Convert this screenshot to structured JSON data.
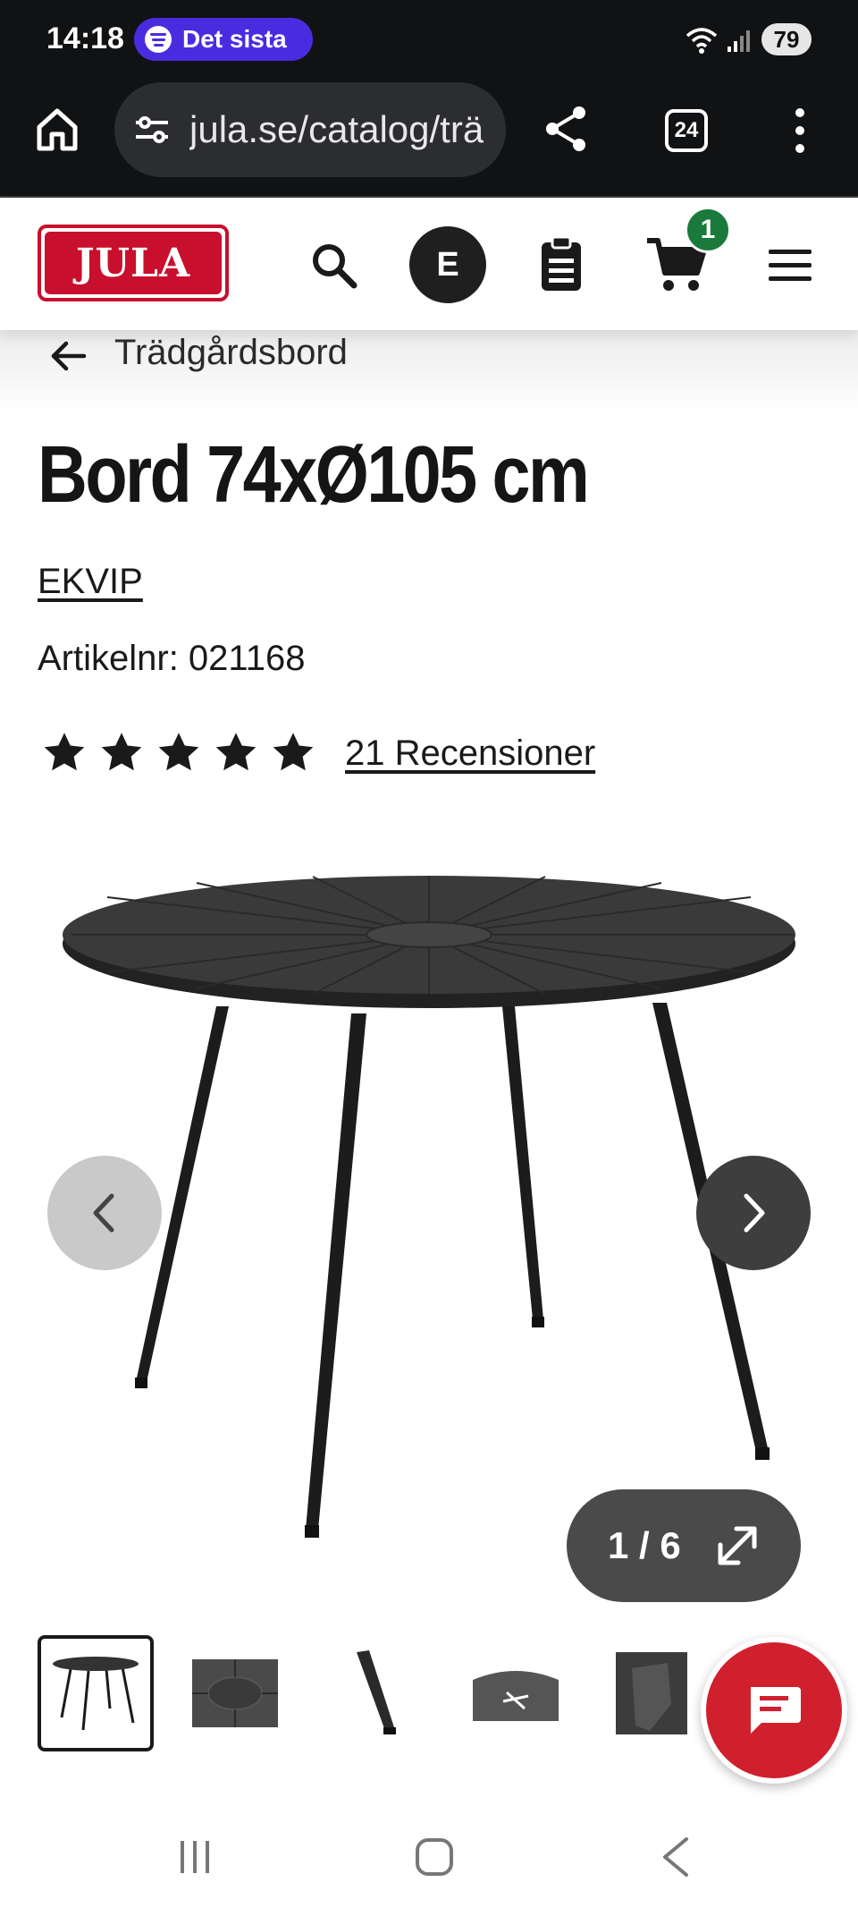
{
  "status_bar": {
    "time": "14:18",
    "media_label": "Det sista",
    "battery": "79"
  },
  "browser": {
    "url": "jula.se/catalog/trä",
    "tab_count": "24"
  },
  "header": {
    "logo_text": "JULA",
    "account_initial": "E",
    "cart_count": "1"
  },
  "breadcrumb": {
    "label": "Trädgårdsbord"
  },
  "product": {
    "title": "Bord 74xØ105 cm",
    "brand": "EKVIP",
    "article": "Artikelnr: 021168",
    "rating_stars": 5,
    "reviews": "21 Recensioner"
  },
  "gallery": {
    "counter": "1 / 6",
    "thumbnails": [
      "table-full",
      "tabletop-top",
      "leg-detail",
      "tabletop-underside",
      "leg-mount"
    ]
  },
  "colors": {
    "brand_red": "#c8102e",
    "badge_green": "#1a7a3c",
    "chat_red": "#d0202e",
    "browser_dark": "#111214"
  }
}
